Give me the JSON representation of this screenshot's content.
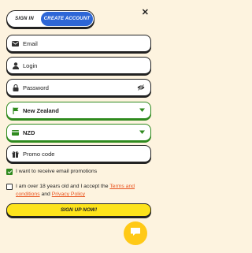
{
  "tabs": {
    "signin": "SIGN IN",
    "create": "CREATE ACCOUNT"
  },
  "close": "✕",
  "fields": {
    "email": "Email",
    "login": "Login",
    "password": "Password",
    "country": "New Zealand",
    "currency": "NZD",
    "promo": "Promo code"
  },
  "icons": [
    "mail-icon",
    "user-icon",
    "lock-icon",
    "eye-off-icon",
    "flag-icon",
    "money-icon",
    "gift-icon",
    "chevron-down-icon",
    "chat-icon",
    "close-icon"
  ],
  "promotions": {
    "label": "I want to receive email promotions",
    "checked": true
  },
  "terms": {
    "prefix": "I am over 18 years old and I accept the ",
    "terms_link": "Terms and conditions",
    "and": " and ",
    "privacy_link": "Privacy Policy",
    "checked": false
  },
  "signup": "SIGN UP NOW!",
  "colors": {
    "accent_blue": "#2d66d6",
    "green": "#2f8a1e",
    "yellow": "#fde31b",
    "link": "#e8541f",
    "background": "#fdf3df"
  }
}
